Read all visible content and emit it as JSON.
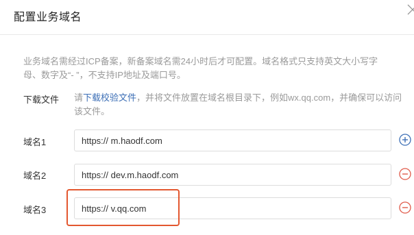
{
  "dialog": {
    "title": "配置业务域名"
  },
  "notice": {
    "text": "业务域名需经过ICP备案，新备案域名需24小时后才可配置。域名格式只支持英文大小写字母、数字及“- ”，不支持IP地址及端口号。"
  },
  "download": {
    "label": "下载文件",
    "prefix": "请",
    "link": "下载校验文件",
    "suffix": "，并将文件放置在域名根目录下，例如wx.qq.com，并确保可以访问该文件。"
  },
  "domains": [
    {
      "label": "域名1",
      "value": "https:// m.haodf.com",
      "action": "add"
    },
    {
      "label": "域名2",
      "value": "https:// dev.m.haodf.com",
      "action": "remove"
    },
    {
      "label": "域名3",
      "value": "https:// v.qq.com",
      "action": "remove"
    }
  ],
  "icons": {
    "close": "close-icon",
    "add": "plus-circle-icon",
    "remove": "minus-circle-icon"
  },
  "colors": {
    "link": "#3d6fb6",
    "add_icon": "#3d6fb6",
    "remove_icon": "#e05a4a",
    "highlight": "#e3572f"
  }
}
